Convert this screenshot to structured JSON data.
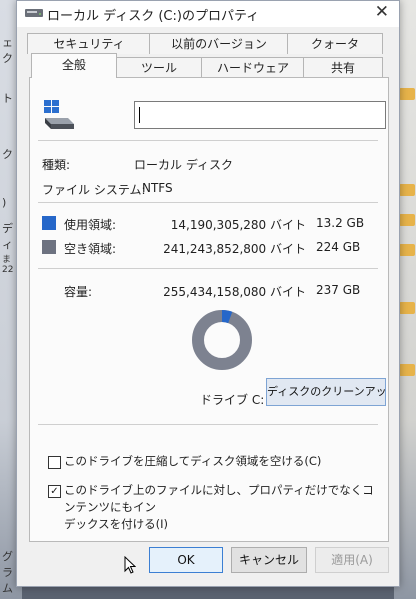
{
  "background": {
    "left_fragments": [
      "ェク",
      "ト",
      "ク",
      ")",
      "ディ",
      "ま 22",
      "グラム"
    ]
  },
  "window": {
    "title": "ローカル ディスク (C:)のプロパティ",
    "close_glyph": "✕"
  },
  "tabs": {
    "row1": [
      "セキュリティ",
      "以前のバージョン",
      "クォータ"
    ],
    "row2": [
      "全般",
      "ツール",
      "ハードウェア",
      "共有"
    ],
    "active": "全般"
  },
  "general": {
    "name_value": "",
    "type_label": "種類:",
    "type_value": "ローカル ディスク",
    "fs_label": "ファイル システム:",
    "fs_value": "NTFS",
    "used": {
      "label": "使用領域:",
      "bytes": "14,190,305,280 バイト",
      "human": "13.2 GB",
      "color": "#2667c9"
    },
    "free": {
      "label": "空き領域:",
      "bytes": "241,243,852,800 バイト",
      "human": "224 GB",
      "color": "#6d7280"
    },
    "capacity": {
      "label": "容量:",
      "bytes": "255,434,158,080 バイト",
      "human": "237 GB"
    },
    "used_fraction": 0.0556,
    "drive_label": "ドライブ C:",
    "cleanup_button": "ディスクのクリーンアップ(D)"
  },
  "options": {
    "compress": {
      "label": "このドライブを圧縮してディスク領域を空ける(C)",
      "checked": false
    },
    "index_line1": "このドライブ上のファイルに対し、プロパティだけでなくコンテンツにもイン",
    "index_line2": "デックスを付ける(I)",
    "index_checked": true,
    "check_glyph": "✓"
  },
  "buttons": {
    "ok": "OK",
    "cancel": "キャンセル",
    "apply": "適用(A)"
  }
}
